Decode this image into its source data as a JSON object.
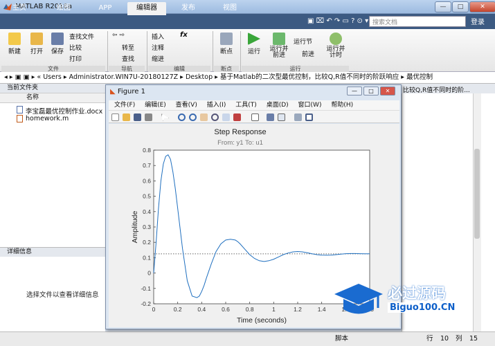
{
  "window": {
    "title": "MATLAB R2018a",
    "controls": [
      "—",
      "□",
      "✕"
    ]
  },
  "tabs": [
    "主页",
    "绘图",
    "APP",
    "编辑器",
    "发布",
    "视图"
  ],
  "active_tab": "编辑器",
  "search_placeholder": "搜索文档",
  "login_label": "登录",
  "ribbon": {
    "file": {
      "new": "新建",
      "open": "打开",
      "save": "保存",
      "find_files": "查找文件",
      "compare": "比较",
      "print": "打印",
      "group": "文件"
    },
    "nav": {
      "goto": "转至",
      "find": "查找",
      "group": "导航"
    },
    "edit": {
      "insert": "插入",
      "comment": "注释",
      "indent": "缩进",
      "fx": "fx",
      "group": "编辑"
    },
    "breakpoints": {
      "label": "断点",
      "group": "断点"
    },
    "run": {
      "run": "运行",
      "run_advance": "运行并\n前进",
      "run_section": "运行节",
      "advance": "前进",
      "run_time": "运行并\n计时",
      "group": "运行"
    }
  },
  "path": {
    "prefix": "« Users",
    "segments": [
      "Administrator.WIN7U-20180127Z",
      "Desktop",
      "基于Matlab的二次型最优控制，比较Q,R值不同时的阶跃响应",
      "最优控制"
    ]
  },
  "current_folder": {
    "title": "当前文件夹",
    "column": "名称",
    "files": [
      "李宝磊最优控制作业.docx",
      "homework.m"
    ]
  },
  "details": {
    "title": "详细信息",
    "placeholder": "选择文件以查看详细信息"
  },
  "right_panel_text": "比较Q,R值不同时的阶...",
  "status": {
    "script": "脚本",
    "row_label": "行",
    "row": "10",
    "col_label": "列",
    "col": "15"
  },
  "figure": {
    "title": "Figure 1",
    "menu": [
      "文件(F)",
      "编辑(E)",
      "查看(V)",
      "插入(I)",
      "工具(T)",
      "桌面(D)",
      "窗口(W)",
      "帮助(H)"
    ]
  },
  "chart_data": {
    "type": "line",
    "title": "Step Response",
    "subtitle": "From: y1  To: u1",
    "xlabel": "Time (seconds)",
    "ylabel": "Amplitude",
    "xlim": [
      0,
      1.8
    ],
    "ylim": [
      -0.2,
      0.8
    ],
    "xticks": [
      "0",
      "0.2",
      "0.4",
      "0.6",
      "0.8",
      "1",
      "1.2",
      "1.4",
      "1.6",
      "1.8"
    ],
    "yticks": [
      "-0.2",
      "-0.1",
      "0",
      "0.1",
      "0.2",
      "0.3",
      "0.4",
      "0.5",
      "0.6",
      "0.7",
      "0.8"
    ],
    "steady_state": 0.125,
    "series": [
      {
        "color": "#1f6fbf",
        "x": [
          0,
          0.02,
          0.04,
          0.06,
          0.08,
          0.1,
          0.12,
          0.14,
          0.16,
          0.18,
          0.2,
          0.24,
          0.28,
          0.32,
          0.36,
          0.38,
          0.4,
          0.42,
          0.44,
          0.48,
          0.52,
          0.56,
          0.6,
          0.64,
          0.68,
          0.7,
          0.72,
          0.76,
          0.8,
          0.84,
          0.88,
          0.92,
          0.96,
          1.0,
          1.04,
          1.08,
          1.12,
          1.16,
          1.2,
          1.24,
          1.28,
          1.32,
          1.36,
          1.4,
          1.44,
          1.48,
          1.52,
          1.56,
          1.6,
          1.64,
          1.68,
          1.72,
          1.76,
          1.8
        ],
        "y": [
          0,
          0.2,
          0.42,
          0.6,
          0.71,
          0.76,
          0.77,
          0.74,
          0.66,
          0.55,
          0.42,
          0.16,
          -0.05,
          -0.15,
          -0.16,
          -0.15,
          -0.12,
          -0.08,
          -0.03,
          0.06,
          0.14,
          0.19,
          0.215,
          0.22,
          0.215,
          0.205,
          0.19,
          0.155,
          0.12,
          0.095,
          0.08,
          0.075,
          0.08,
          0.09,
          0.105,
          0.12,
          0.13,
          0.138,
          0.14,
          0.138,
          0.132,
          0.125,
          0.12,
          0.117,
          0.116,
          0.117,
          0.12,
          0.123,
          0.126,
          0.127,
          0.127,
          0.126,
          0.125,
          0.125
        ]
      }
    ]
  },
  "watermark": {
    "text": "必过源码",
    "url": "Biguo100.CN"
  },
  "colors": {
    "tab_bar": "#3c5a82",
    "accent": "#1f6fbf",
    "watermark": "#0d5fc9"
  }
}
